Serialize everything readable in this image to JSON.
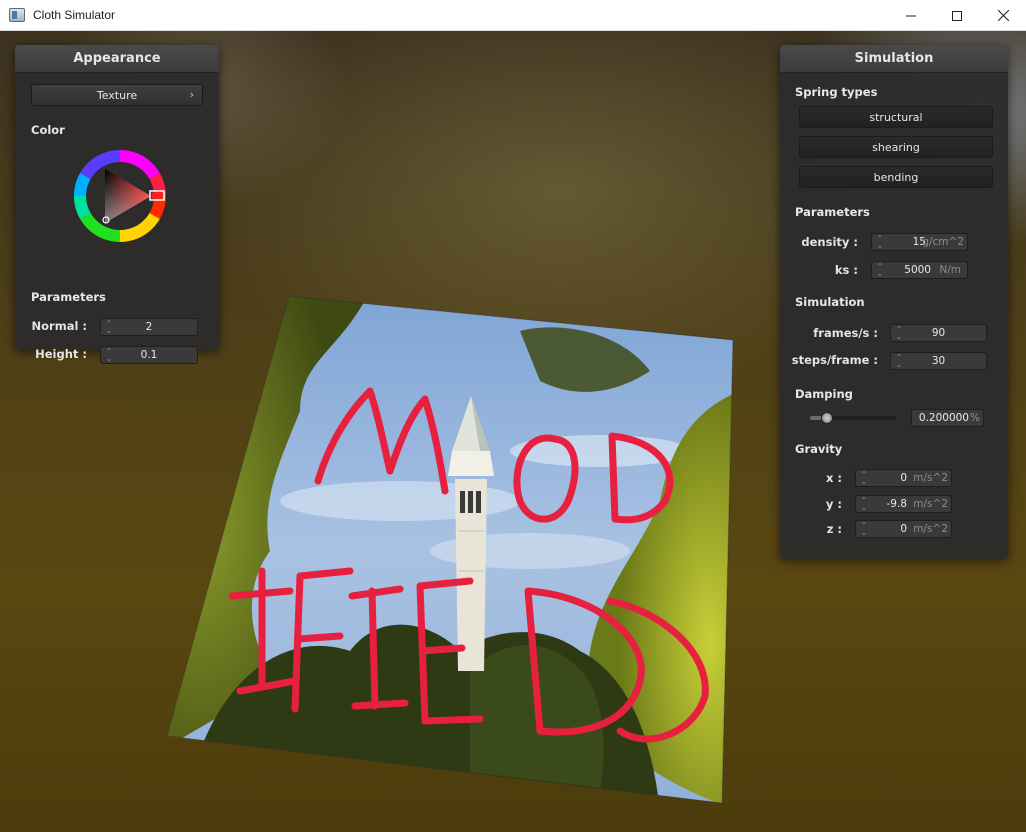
{
  "window": {
    "title": "Cloth Simulator",
    "controls": [
      "minimize-icon",
      "maximize-icon",
      "close-icon"
    ]
  },
  "appearance": {
    "title": "Appearance",
    "shader_button": "Texture",
    "shader_chevron": "›",
    "color_label": "Color",
    "params_label": "Parameters",
    "normal_label": "Normal :",
    "normal_value": "2",
    "height_label": "Height :",
    "height_value": "0.1",
    "wheel_selected_hue": 0
  },
  "simulation": {
    "title": "Simulation",
    "spring_types_label": "Spring types",
    "spring_buttons": [
      "structural",
      "shearing",
      "bending"
    ],
    "parameters_label": "Parameters",
    "density_label": "density :",
    "density_value": "15",
    "density_unit": "g/cm^2",
    "ks_label": "ks :",
    "ks_value": "5000",
    "ks_unit": "N/m",
    "sim_label": "Simulation",
    "fps_label": "frames/s :",
    "fps_value": "90",
    "steps_label": "steps/frame :",
    "steps_value": "30",
    "damping_label": "Damping",
    "damping_value": "0.200000",
    "damping_unit": "%",
    "damping_fraction": 0.2,
    "gravity_label": "Gravity",
    "gx_label": "x :",
    "gx_value": "0",
    "gy_label": "y :",
    "gy_value": "-9.8",
    "gz_label": "z :",
    "gz_value": "0",
    "gravity_unit": "m/s^2"
  },
  "cloth": {
    "texture_text_line1": "MOD",
    "texture_text_line2": "IFIED",
    "text_color": "#e8203f"
  }
}
